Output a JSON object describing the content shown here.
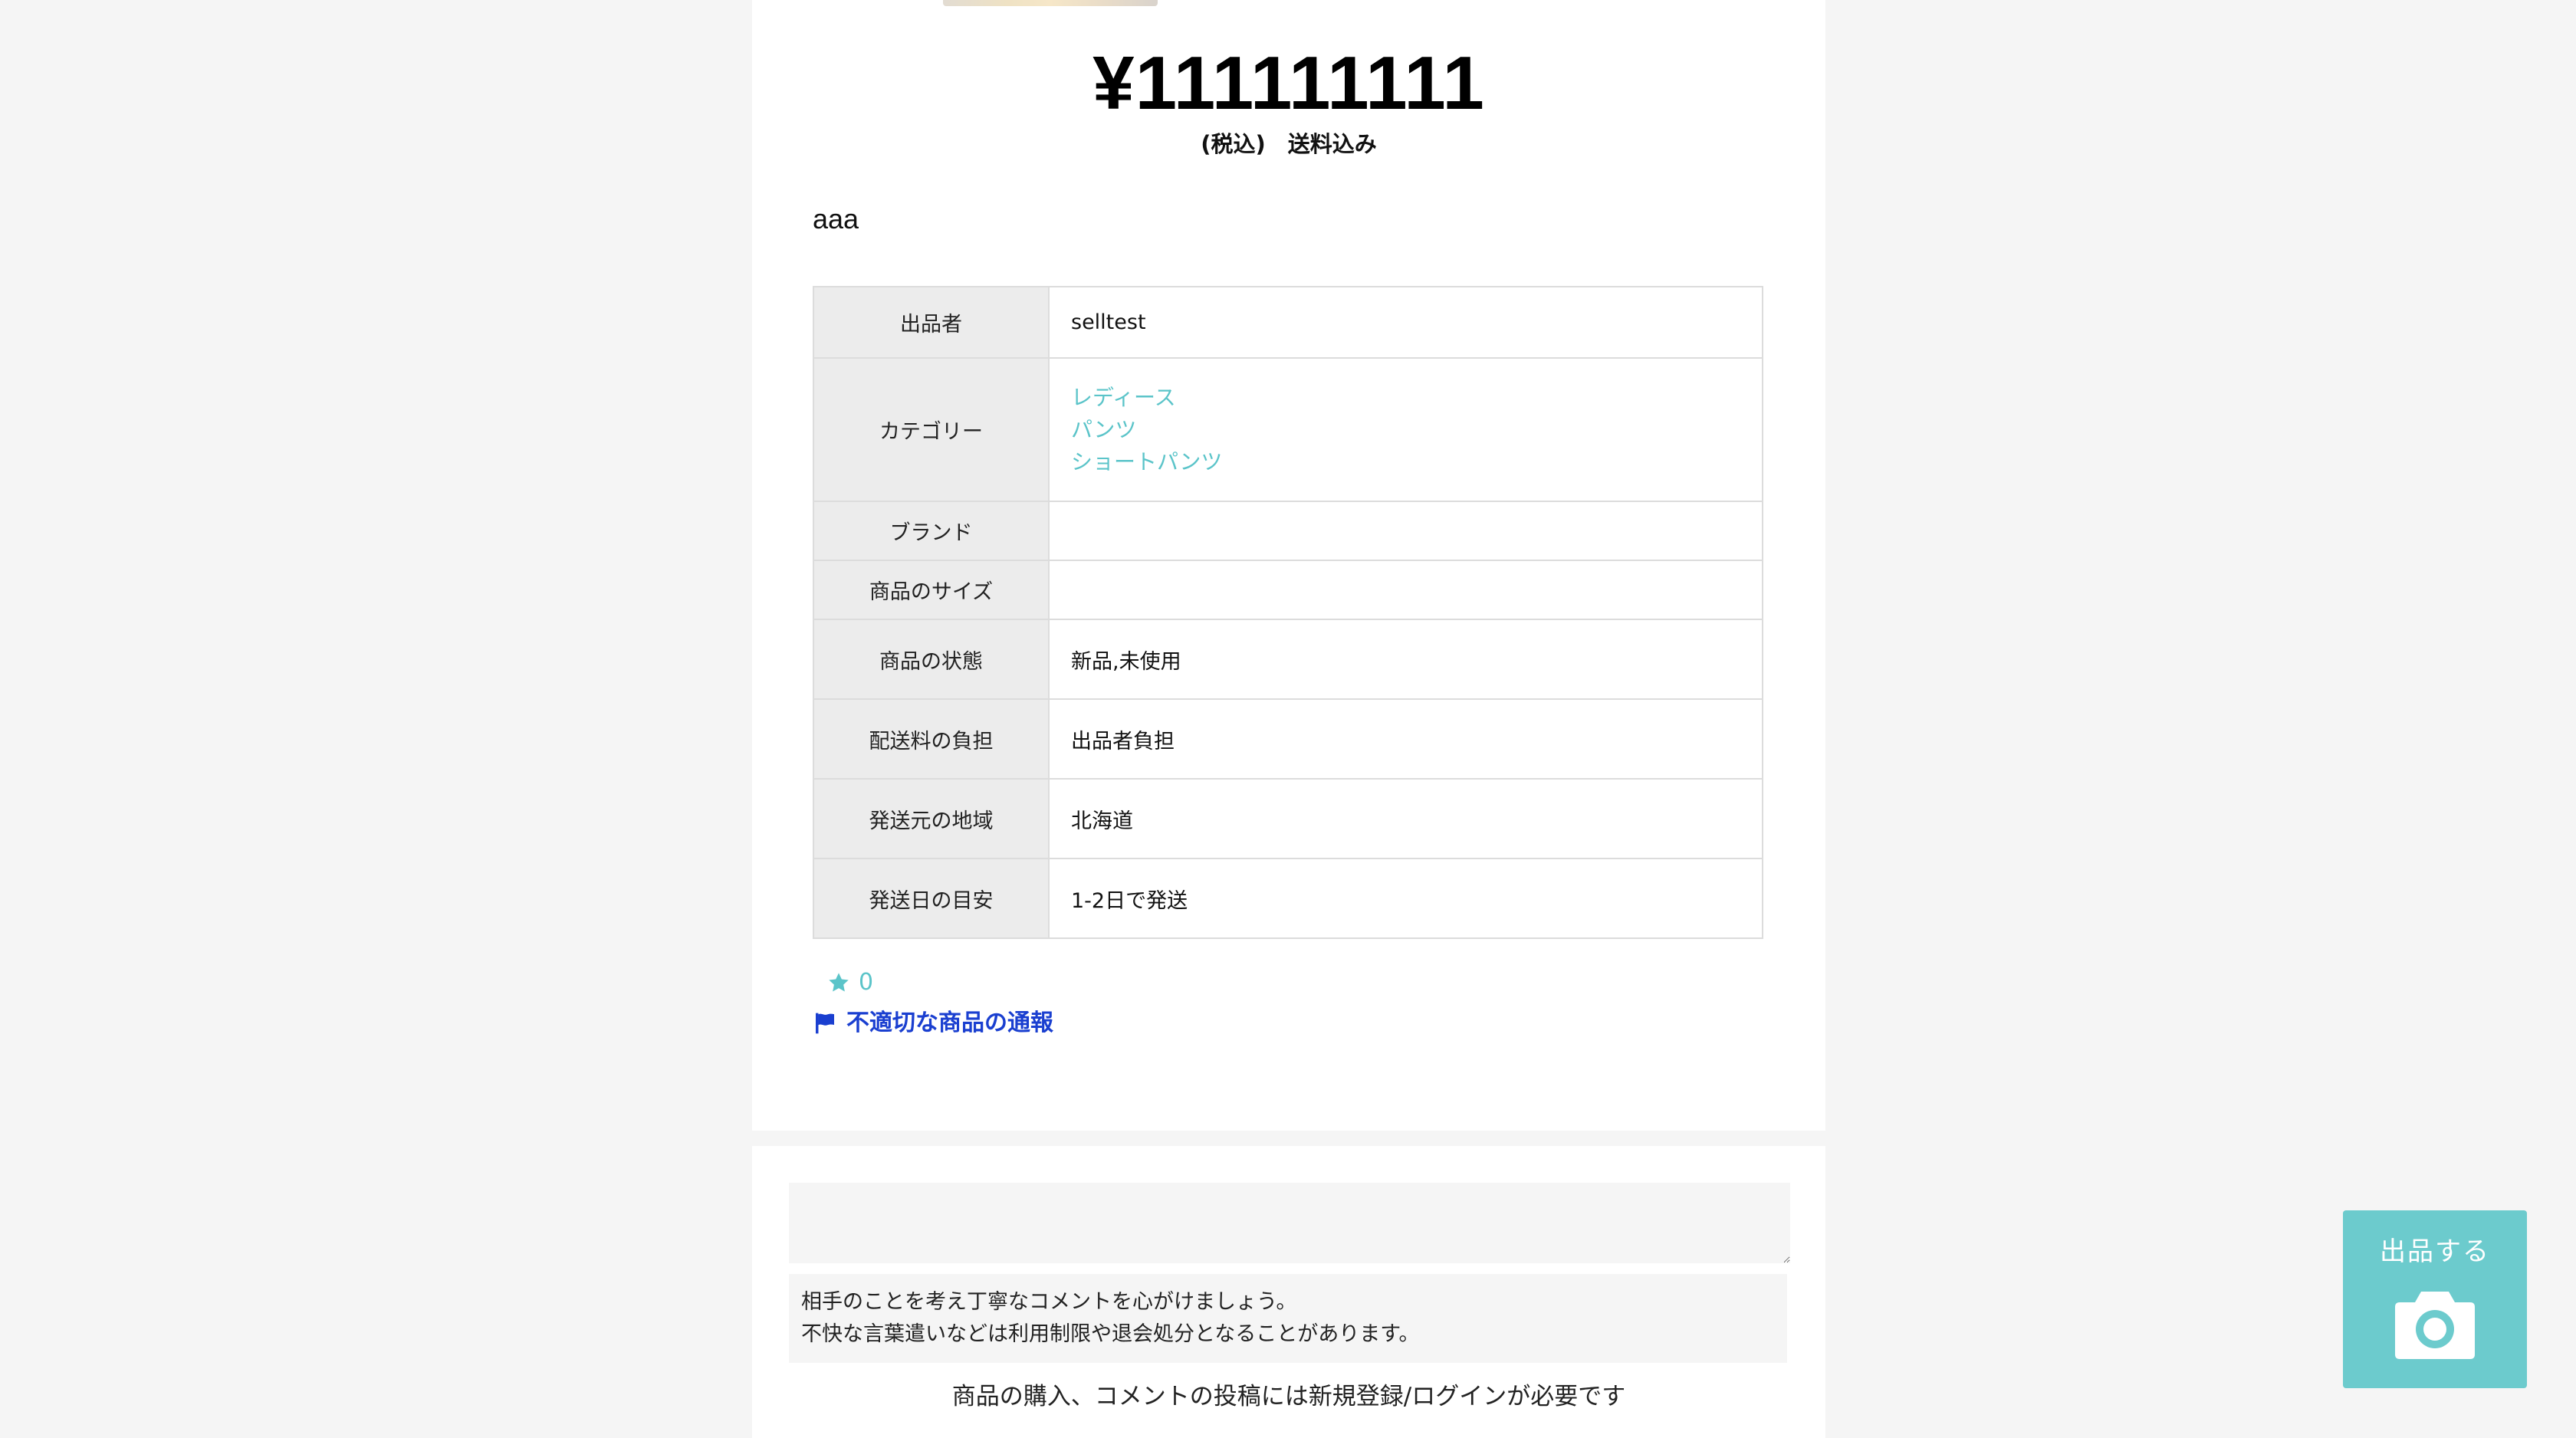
{
  "item": {
    "price": "¥111111111",
    "tax_note": "(税込)　送料込み",
    "description": "aaa"
  },
  "details": {
    "seller": {
      "label": "出品者",
      "value": "selltest"
    },
    "category": {
      "label": "カテゴリー",
      "links": [
        "レディース",
        "パンツ",
        "ショートパンツ"
      ]
    },
    "brand": {
      "label": "ブランド",
      "value": ""
    },
    "size": {
      "label": "商品のサイズ",
      "value": ""
    },
    "condition": {
      "label": "商品の状態",
      "value": "新品,未使用"
    },
    "shipping_fee": {
      "label": "配送料の負担",
      "value": "出品者負担"
    },
    "ship_from": {
      "label": "発送元の地域",
      "value": "北海道"
    },
    "ship_days": {
      "label": "発送日の目安",
      "value": "1-2日で発送"
    }
  },
  "actions": {
    "like_count": "0",
    "report_label": "不適切な商品の通報"
  },
  "comments": {
    "notice_line1": "相手のことを考え丁寧なコメントを心がけましょう。",
    "notice_line2": "不快な言葉遣いなどは利用制限や退会処分となることがあります。",
    "login_note": "商品の購入、コメントの投稿には新規登録/ログインが必要です"
  },
  "sell_button": {
    "label": "出品する"
  },
  "colors": {
    "accent": "#6ccbcd",
    "link": "#5bc4c9",
    "report": "#1a3fd0"
  },
  "icons": {
    "like": "star-icon",
    "report": "flag-icon",
    "sell": "camera-icon"
  }
}
